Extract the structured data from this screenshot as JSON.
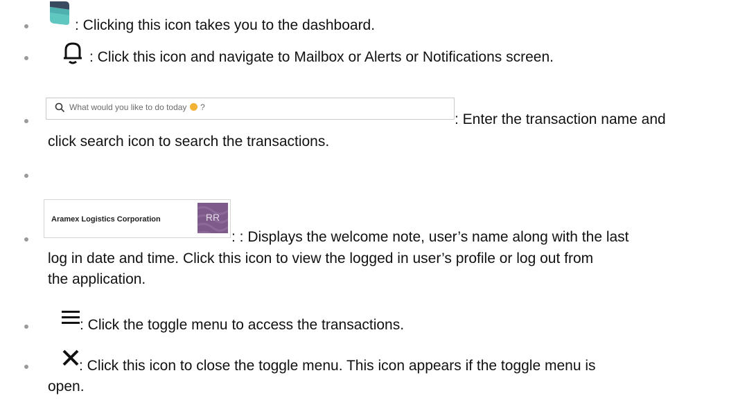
{
  "items": [
    {
      "icon": "dashboard-icon",
      "text": ": Clicking this icon takes you to the dashboard."
    },
    {
      "icon": "bell-icon",
      "text": ": Click this icon and navigate to Mailbox or Alerts or Notifications screen."
    },
    {
      "icon": "search-box",
      "search_placeholder": "What would you like to do today",
      "search_placeholder_suffix": "?",
      "text_line1": ": Enter the transaction name and",
      "text_line2": "click search icon to search the transactions."
    },
    {
      "text": ""
    },
    {
      "icon": "user-profile-badge",
      "org_name": "Aramex Logistics Corporation",
      "avatar_initials": "RR",
      "text_line1": ": :  Displays the welcome note, user’s name along with the last",
      "text_line2": "log in date and time. Click this icon to view the logged in user’s profile or log out from",
      "text_line3": "the application."
    },
    {
      "icon": "hamburger-menu-icon",
      "text": ": Click the toggle menu to access the transactions."
    },
    {
      "icon": "close-icon",
      "text_line1": ": Click this icon to close the toggle menu. This icon appears if the toggle menu is",
      "text_line2": "open."
    }
  ],
  "colors": {
    "dashboard_top": "#3a4a5e",
    "dashboard_bottom": "#5fc6c0",
    "avatar": "#7d5a8a",
    "bullet": "#9a9a9a"
  }
}
